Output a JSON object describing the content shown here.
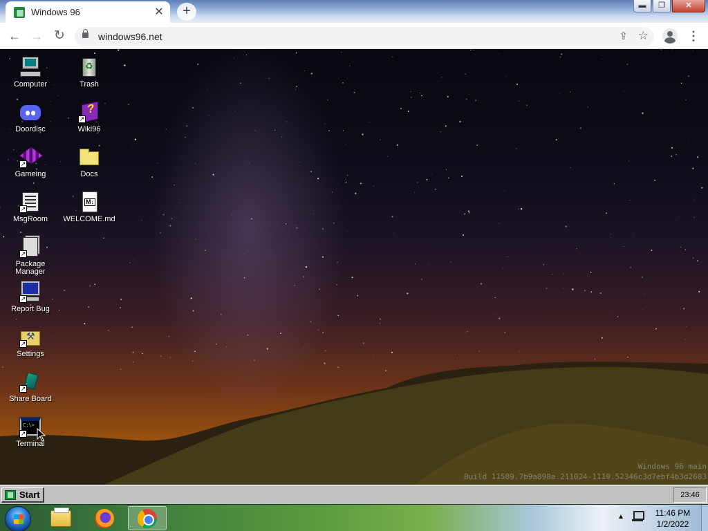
{
  "browser": {
    "tab_title": "Windows 96",
    "tab_close": "✕",
    "new_tab": "+",
    "url": "windows96.net",
    "back": "←",
    "forward": "→",
    "reload": "↻",
    "share": "⇪",
    "star": "☆",
    "menu": "⋮",
    "window_controls": {
      "minimize": "▬",
      "restore": "❐",
      "close": "✕"
    }
  },
  "desktop": {
    "icons": [
      {
        "label": "Computer",
        "icon": "computer-icon"
      },
      {
        "label": "Trash",
        "icon": "trash-icon"
      },
      {
        "label": "Doordisc",
        "icon": "discord-icon"
      },
      {
        "label": "Wiki96",
        "icon": "wiki-book-icon"
      },
      {
        "label": "Gameing",
        "icon": "cube-icon"
      },
      {
        "label": "Docs",
        "icon": "folder-icon"
      },
      {
        "label": "MsgRoom",
        "icon": "message-board-icon"
      },
      {
        "label": "WELCOME.md",
        "icon": "markdown-file-icon"
      },
      {
        "label": "Package Manager",
        "icon": "package-icon"
      },
      {
        "label": "Report Bug",
        "icon": "monitor-icon"
      },
      {
        "label": "Settings",
        "icon": "settings-folder-icon"
      },
      {
        "label": "Share Board",
        "icon": "share-board-icon"
      },
      {
        "label": "Terminal",
        "icon": "terminal-icon"
      }
    ],
    "watermark": {
      "line1": "Windows 96 main",
      "line2": "Build 11589.7b9a898a.211024-1119.52346c3d7ebf4b3d2683"
    }
  },
  "w96_taskbar": {
    "start_label": "Start",
    "clock": "23:46"
  },
  "host_taskbar": {
    "pinned": [
      {
        "name": "File Explorer",
        "icon": "folder-icon"
      },
      {
        "name": "Firefox",
        "icon": "firefox-icon"
      },
      {
        "name": "Chrome",
        "icon": "chrome-icon",
        "active": true
      }
    ],
    "tray_arrow": "▲",
    "time": "11:46 PM",
    "date": "1/2/2022"
  }
}
